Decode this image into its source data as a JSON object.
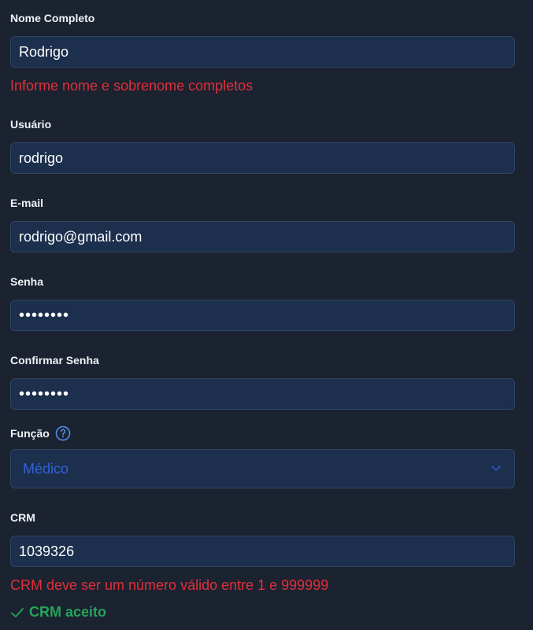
{
  "form": {
    "full_name": {
      "label": "Nome Completo",
      "value": "Rodrigo",
      "error": "Informe nome e sobrenome completos"
    },
    "username": {
      "label": "Usuário",
      "value": "rodrigo"
    },
    "email": {
      "label": "E-mail",
      "value": "rodrigo@gmail.com"
    },
    "password": {
      "label": "Senha",
      "value": "••••••••"
    },
    "confirm_password": {
      "label": "Confirmar Senha",
      "value": "••••••••"
    },
    "role": {
      "label": "Função",
      "help_icon": "question-circle-icon",
      "selected": "Médico",
      "chevron_icon": "chevron-down-icon"
    },
    "crm": {
      "label": "CRM",
      "value": "1039326",
      "error": "CRM deve ser um número válido entre 1 e 999999",
      "success": "CRM aceito",
      "success_icon": "check-icon"
    }
  },
  "colors": {
    "background": "#1b2230",
    "field_bg": "#1c2f4d",
    "field_border": "#2f4566",
    "error": "#e0303a",
    "success": "#25a55a",
    "accent": "#2f63d9"
  }
}
